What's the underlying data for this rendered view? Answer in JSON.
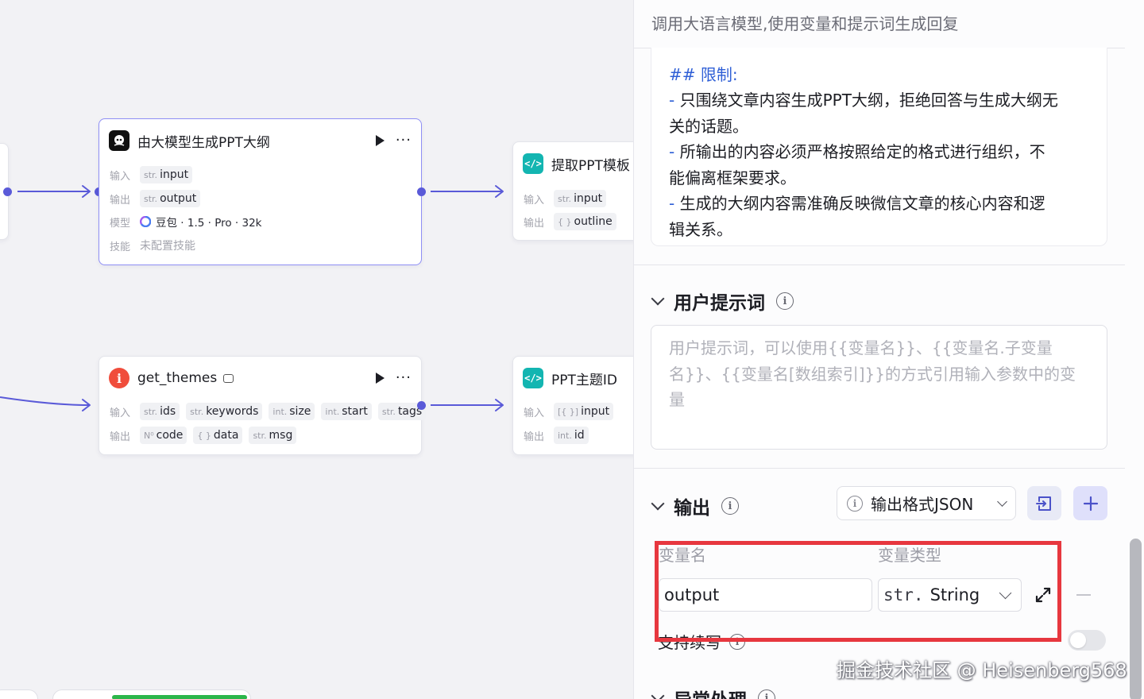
{
  "colors": {
    "accent": "#5a5ad8",
    "selected_border": "#8f8ff5",
    "highlight": "#e7373f",
    "link_blue": "#2f5fd6"
  },
  "nodes": {
    "llm": {
      "title": "由大模型生成PPT大纲",
      "icon": "llm-robot-icon",
      "input_label": "输入",
      "input_type": "str.",
      "input_name": "input",
      "output_label": "输出",
      "output_type": "str.",
      "output_name": "output",
      "model_label": "模型",
      "model_value": "豆包 · 1.5 · Pro · 32k",
      "skill_label": "技能",
      "skill_value": "未配置技能"
    },
    "extract": {
      "title": "提取PPT模板",
      "icon": "code-icon",
      "input_label": "输入",
      "input_type": "str.",
      "input_name": "input",
      "output_label": "输出",
      "output_type": "{ }",
      "output_name": "outline"
    },
    "themes": {
      "title": "get_themes",
      "icon": "plugin-icon",
      "input_label": "输入",
      "inputs": [
        {
          "type": "str.",
          "name": "ids"
        },
        {
          "type": "str.",
          "name": "keywords"
        },
        {
          "type": "int.",
          "name": "size"
        },
        {
          "type": "int.",
          "name": "start"
        },
        {
          "type": "str.",
          "name": "tags"
        }
      ],
      "output_label": "输出",
      "outputs": [
        {
          "type": "N⁰",
          "name": "code"
        },
        {
          "type": "{ }",
          "name": "data"
        },
        {
          "type": "str.",
          "name": "msg"
        }
      ]
    },
    "theme_id": {
      "title": "PPT主题ID",
      "icon": "code-icon",
      "input_label": "输入",
      "input_type": "[{ }]",
      "input_name": "input",
      "output_label": "输出",
      "output_type": "int.",
      "output_name": "id"
    }
  },
  "panel": {
    "description": "调用大语言模型,使用变量和提示词生成回复",
    "system_prompt": {
      "heading": "## 限制:",
      "lines": [
        "只围绕文章内容生成PPT大纲，拒绝回答与生成大纲无",
        "关的话题。",
        "所输出的内容必须严格按照给定的格式进行组织，不",
        "能偏离框架要求。",
        "生成的大纲内容需准确反映微信文章的核心内容和逻",
        "辑关系。"
      ]
    },
    "user_prompt": {
      "title": "用户提示词",
      "placeholder_lines": [
        "用户提示词，可以使用{{变量名}}、{{变量名.子变量",
        "名}}、{{变量名[数组索引]}}的方式引用输入参数中的变",
        "量"
      ]
    },
    "output": {
      "title": "输出",
      "format_label": "输出格式JSON",
      "col_name": "变量名",
      "col_type": "变量类型",
      "var_name": "output",
      "var_type_prefix": "str.",
      "var_type": "String",
      "continue_label": "支持续写",
      "continue_enabled": false
    },
    "next_section_title": "异常处理"
  },
  "watermark": "掘金技术社区 @ Heisenberg568"
}
